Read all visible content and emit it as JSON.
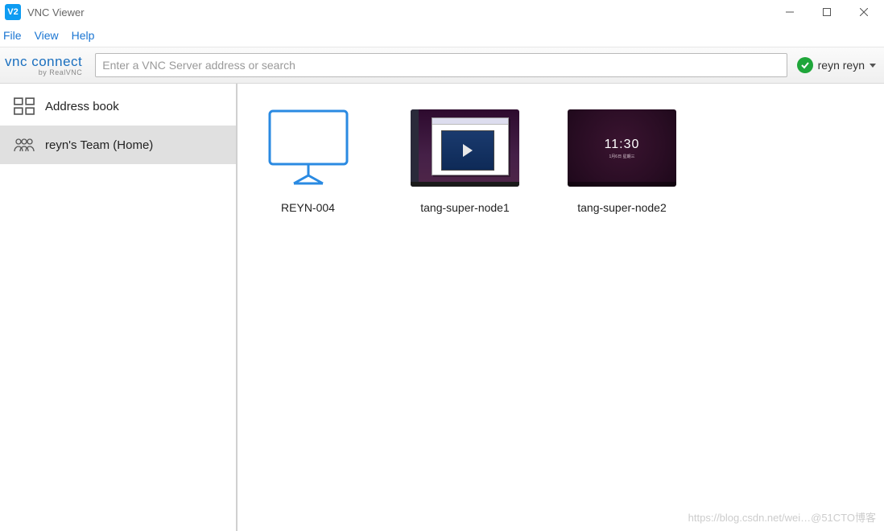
{
  "window": {
    "title": "VNC Viewer",
    "icon_label": "V2"
  },
  "menu": {
    "items": [
      "File",
      "View",
      "Help"
    ]
  },
  "toolbar": {
    "logo_main": "vnc connect",
    "logo_sub": "by RealVNC",
    "search_placeholder": "Enter a VNC Server address or search",
    "user_name": "reyn reyn"
  },
  "sidebar": {
    "items": [
      {
        "label": "Address book",
        "selected": false
      },
      {
        "label": "reyn's Team (Home)",
        "selected": true
      }
    ]
  },
  "connections": [
    {
      "label": "REYN-004",
      "kind": "placeholder"
    },
    {
      "label": "tang-super-node1",
      "kind": "shot1"
    },
    {
      "label": "tang-super-node2",
      "kind": "shot2",
      "lock_time": "11:30",
      "lock_date": "1月6日 星期三"
    }
  ],
  "watermark": "https://blog.csdn.net/wei…@51CTO博客"
}
